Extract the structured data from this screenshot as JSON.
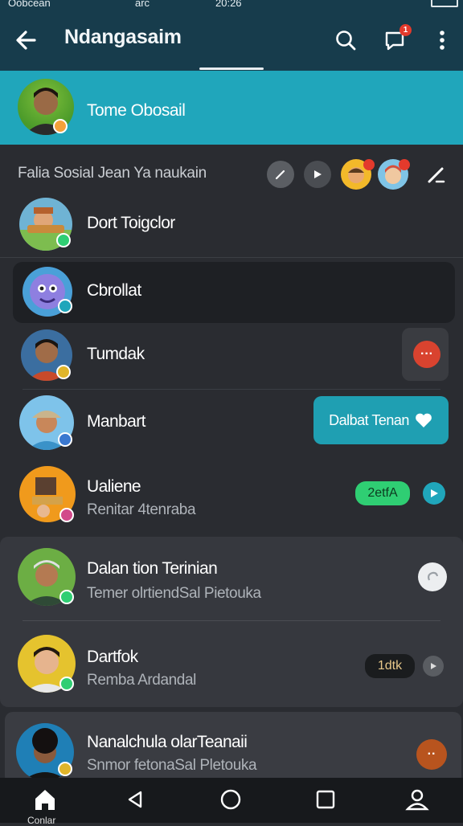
{
  "status_bar": {
    "carrier": "Oobcean",
    "network": "arc",
    "time": "20:26"
  },
  "app_bar": {
    "title": "Ndangasaim",
    "notification_count": "1"
  },
  "banner": {
    "name": "Tome Obosail"
  },
  "section": {
    "title": "Falia Sosial Jean Ya naukain"
  },
  "contacts": [
    {
      "name": "Dort Toigclor",
      "subtitle": ""
    },
    {
      "name": "Cbrollat",
      "subtitle": ""
    },
    {
      "name": "Tumdak",
      "subtitle": "",
      "action_glyph": "···"
    },
    {
      "name": "Manbart",
      "subtitle": "",
      "bubble": "Dalbat Tenan"
    },
    {
      "name": "Ualiene",
      "subtitle": "Renitar 4tenraba",
      "badge": "2etfA"
    },
    {
      "name": "Dalan tion Terinian",
      "subtitle": "Temer olrtiendSal Pietouka"
    },
    {
      "name": "Dartfok",
      "subtitle": "Remba Ardandal",
      "badge": "1dtk"
    },
    {
      "name": "Nanalchula olarTeanaii",
      "subtitle": "Snmor fetonaSal Pletouka",
      "action_glyph": "··"
    }
  ],
  "nav": {
    "home_label": "Conlar"
  },
  "colors": {
    "header": "#173c4c",
    "accent": "#20a6bb",
    "badge_green": "#2fce73",
    "danger": "#d9432f",
    "background": "#2a2c31"
  },
  "icons": [
    "back-arrow-icon",
    "search-icon",
    "chat-icon",
    "more-vert-icon",
    "pencil-icon",
    "play-icon",
    "home-icon",
    "back-icon",
    "circle-home-icon",
    "square-recents-icon",
    "person-icon",
    "heart-icon"
  ]
}
